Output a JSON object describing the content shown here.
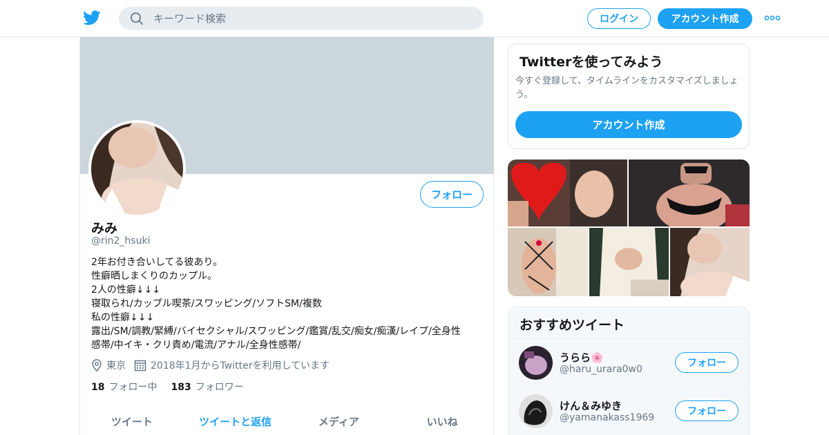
{
  "header": {
    "search_placeholder": "キーワード検索",
    "login_label": "ログイン",
    "signup_label": "アカウント作成"
  },
  "profile": {
    "name": "みみ",
    "handle": "@rin2_hsuki",
    "follow_label": "フォロー",
    "bio_lines": [
      "2年お付き合いしてる彼あり。",
      "性癖晒しまくりのカップル。",
      "2人の性癖↓↓↓",
      "寝取られ/カップル喫茶/スワッピング/ソフトSM/複数",
      "私の性癖↓↓↓",
      "露出/SM/調教/緊縛/バイセクシャル/スワッピング/鑑賞/乱交/痴女/痴漢/レイプ/全身性",
      "感帯/中イキ・クリ責め/電流/アナル/全身性感帯/"
    ],
    "location": "東京",
    "joined": "2018年1月からTwitterを利用しています",
    "following_count": "18",
    "following_label": "フォロー中",
    "followers_count": "183",
    "followers_label": "フォロワー",
    "tabs": [
      "ツイート",
      "ツイートと返信",
      "メディア",
      "いいね"
    ],
    "active_tab": 1
  },
  "signup_card": {
    "title": "Twitterを使ってみよう",
    "description": "今すぐ登録して、タイムラインをカスタマイズしましょう。",
    "button_label": "アカウント作成"
  },
  "recommended": {
    "title": "おすすめツイート",
    "users": [
      {
        "name": "うらら🌸",
        "handle": "@haru_urara0w0",
        "follow_label": "フォロー"
      },
      {
        "name": "けん＆みゆき",
        "handle": "@yamanakass1969",
        "follow_label": "フォロー"
      }
    ]
  },
  "colors": {
    "accent": "#1da1f2",
    "banner": "#ccd6dd",
    "muted": "#657786"
  },
  "icons": [
    "twitter-bird-icon",
    "search-icon",
    "more-dots-icon",
    "location-pin-icon",
    "calendar-icon"
  ]
}
